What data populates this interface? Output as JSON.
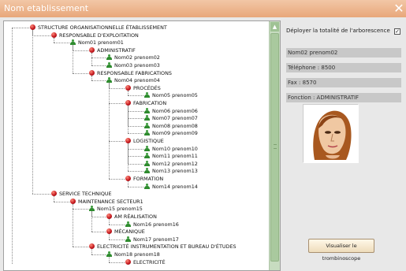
{
  "window": {
    "title": "Nom etablissement",
    "close_symbol": "✕"
  },
  "tree": {
    "nodes": [
      {
        "label": "STRUCTURE ORGANISATIONNELLE ÉTABLISSEMENT",
        "kind": "unit"
      },
      {
        "label": "RESPONSABLE D'EXPLOITATION",
        "kind": "unit"
      },
      {
        "label": "Nom01 prenom01",
        "kind": "person"
      },
      {
        "label": "ADMINISTRATIF",
        "kind": "unit"
      },
      {
        "label": "Nom02 prenom02",
        "kind": "person"
      },
      {
        "label": "Nom03 prenom03",
        "kind": "person"
      },
      {
        "label": "RESPONSABLE FABRICATIONS",
        "kind": "unit"
      },
      {
        "label": "Nom04 prenom04",
        "kind": "person"
      },
      {
        "label": "PROCÉDÉS",
        "kind": "unit"
      },
      {
        "label": "Nom05 prenom05",
        "kind": "person"
      },
      {
        "label": "FABRICATION",
        "kind": "unit"
      },
      {
        "label": "Nom06 prenom06",
        "kind": "person"
      },
      {
        "label": "Nom07 prenom07",
        "kind": "person"
      },
      {
        "label": "Nom08 prenom08",
        "kind": "person"
      },
      {
        "label": "Nom09 prenom09",
        "kind": "person"
      },
      {
        "label": "LOGISTIQUE",
        "kind": "unit"
      },
      {
        "label": "Nom10 prenom10",
        "kind": "person"
      },
      {
        "label": "Nom11 prenom11",
        "kind": "person"
      },
      {
        "label": "Nom12 prenom12",
        "kind": "person"
      },
      {
        "label": "Nom13 prenom13",
        "kind": "person"
      },
      {
        "label": "FORMATION",
        "kind": "unit"
      },
      {
        "label": "Nom14 prenom14",
        "kind": "person"
      },
      {
        "label": "SERVICE TECHNIQUE",
        "kind": "unit"
      },
      {
        "label": "MAINTENANCE SECTEUR1",
        "kind": "unit"
      },
      {
        "label": "Nom15 prenom15",
        "kind": "person"
      },
      {
        "label": "AM RÉALISATION",
        "kind": "unit"
      },
      {
        "label": "Nom16 prenom16",
        "kind": "person"
      },
      {
        "label": "MÉCANIQUE",
        "kind": "unit"
      },
      {
        "label": "Nom17 prenom17",
        "kind": "person"
      },
      {
        "label": "ELECTRICITÉ INSTRUMENTATION ET BUREAU D'ÉTUDES",
        "kind": "unit"
      },
      {
        "label": "Nom18 prenom18",
        "kind": "person"
      },
      {
        "label": "ELECTRICITÉ",
        "kind": "unit"
      }
    ]
  },
  "info": {
    "deploy_label": "Déployer la totalité de l'arborescence",
    "deploy_checked": true,
    "check_mark": "✓",
    "name": "Nom02 prenom02",
    "phone": "Téléphone : 8500",
    "fax": "Fax : 8570",
    "function": "Fonction : ADMINISTRATIF",
    "trombi_button": "Visualiser le trombinoscope"
  },
  "colors": {
    "titlebar": "#e8a77a",
    "unit_dot": "#c0141b",
    "person_icon": "#2e8b2e",
    "scrollbar": "#c7dcc0"
  }
}
